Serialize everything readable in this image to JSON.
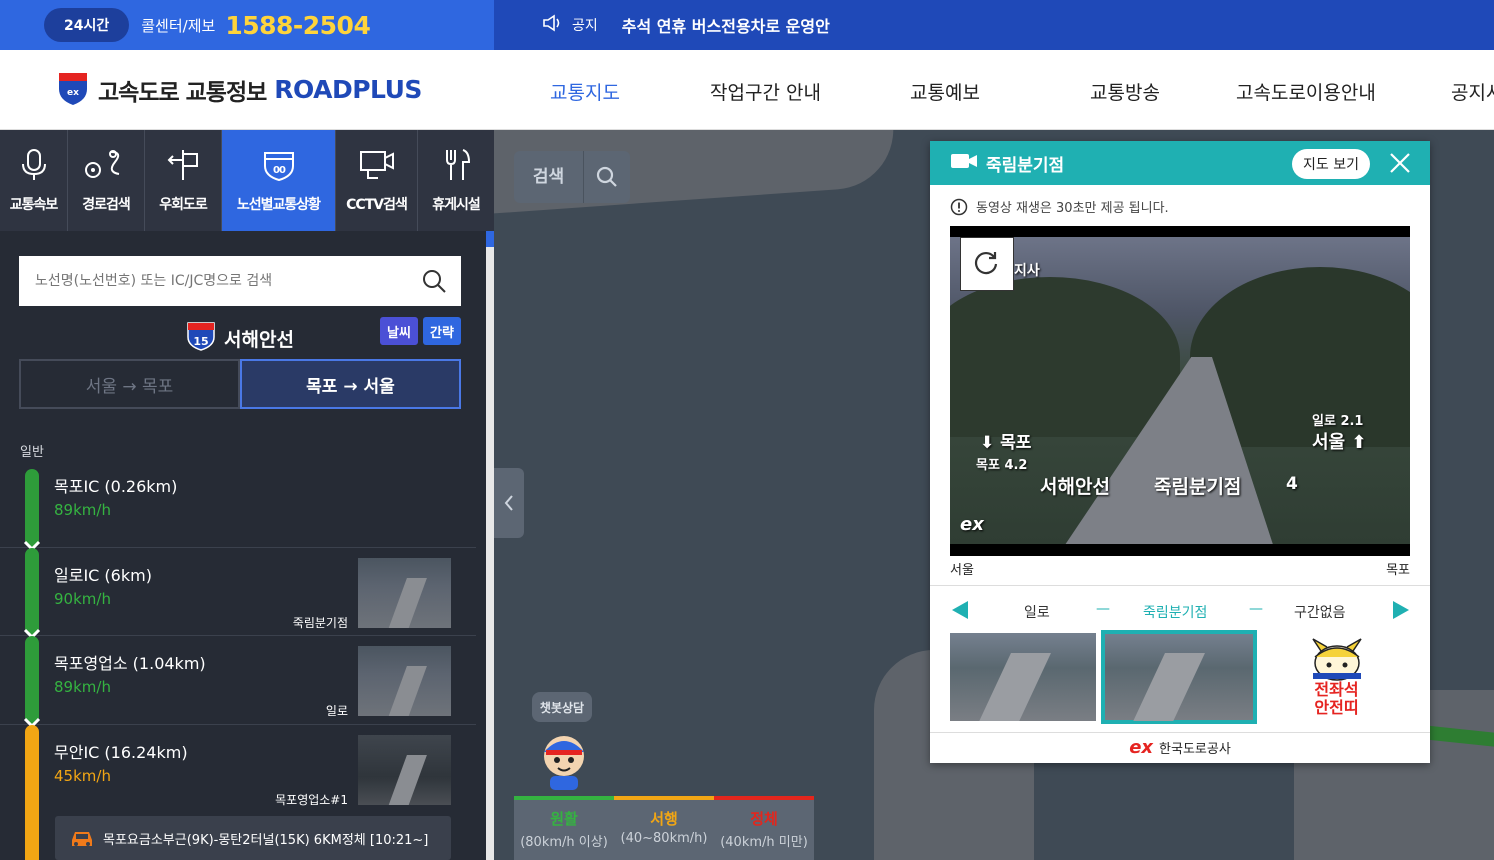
{
  "topbar": {
    "hours_badge": "24시간",
    "callcenter_label": "콜센터/제보",
    "phone": "1588-2504",
    "notice_label": "공지",
    "notice_text": "추석 연휴 버스전용차로 운영안"
  },
  "header": {
    "brand_ko": "고속도로 교통정보",
    "brand_en": "ROADPLUS",
    "nav": [
      {
        "label": "교통지도",
        "active": true
      },
      {
        "label": "작업구간 안내",
        "active": false
      },
      {
        "label": "교통예보",
        "active": false
      },
      {
        "label": "교통방송",
        "active": false
      },
      {
        "label": "고속도로이용안내",
        "active": false
      },
      {
        "label": "공지사",
        "active": false
      }
    ]
  },
  "tabs": [
    {
      "label": "교통속보",
      "icon": "microphone-icon",
      "active": false
    },
    {
      "label": "경로검색",
      "icon": "route-icon",
      "active": false
    },
    {
      "label": "우회도로",
      "icon": "detour-sign-icon",
      "active": false
    },
    {
      "label": "노선별교통상황",
      "icon": "route-shield-icon",
      "active": true
    },
    {
      "label": "CCTV검색",
      "icon": "monitor-icon",
      "active": false
    },
    {
      "label": "휴게시설",
      "icon": "fork-knife-icon",
      "active": false
    }
  ],
  "panel": {
    "search_placeholder": "노선명(노선번호) 또는 IC/JC명으로 검색",
    "route_number": "15",
    "route_name": "서해안선",
    "weather_btn": "날씨",
    "brief_btn": "간략",
    "dir_left": "서울 → 목포",
    "dir_right": "목포 → 서울",
    "general_label": "일반",
    "segments": [
      {
        "title": "목포IC (0.26km)",
        "speed": "89km/h",
        "color": "#2e9c3a",
        "speed_color": "#35b341",
        "cam_label": "",
        "has_thumb": false
      },
      {
        "title": "일로IC (6km)",
        "speed": "90km/h",
        "color": "#2e9c3a",
        "speed_color": "#35b341",
        "cam_label": "죽림분기점",
        "has_thumb": true
      },
      {
        "title": "목포영업소 (1.04km)",
        "speed": "89km/h",
        "color": "#2e9c3a",
        "speed_color": "#35b341",
        "cam_label": "일로",
        "has_thumb": true
      },
      {
        "title": "무안IC (16.24km)",
        "speed": "45km/h",
        "color": "#f2a614",
        "speed_color": "#f2a614",
        "cam_label": "목포영업소#1",
        "has_thumb": true
      }
    ],
    "incident_text": "목포요금소부근(9K)-몽탄2터널(15K) 6KM정체 [10:21~]"
  },
  "map": {
    "search_label": "검색",
    "chatbot_label": "챗봇상담",
    "legend": [
      {
        "name": "원활",
        "range": "(80km/h 이상)",
        "color": "#35b341"
      },
      {
        "name": "서행",
        "range": "(40~80km/h)",
        "color": "#f2a614"
      },
      {
        "name": "정체",
        "range": "(40km/h 미만)",
        "color": "#e3261d"
      }
    ]
  },
  "popup": {
    "title": "죽림분기점",
    "map_btn": "지도 보기",
    "notice": "동영상 재생은 30초만 제공 됩니다.",
    "video_overlay": {
      "top_left": "지사",
      "dir_down": "목포",
      "km_left": "목포 4.2",
      "route": "서해안선",
      "junction": "죽림분기점",
      "number": "4",
      "km_right": "일로 2.1",
      "dir_up": "서울",
      "logo": "ex"
    },
    "cap_left": "서울",
    "cap_right": "목포",
    "nav_prev": "일로",
    "nav_current": "죽림분기점",
    "nav_next": "구간없음",
    "dash": "—",
    "ad_line1": "전좌석",
    "ad_line2": "안전띠",
    "corp": "한국도로공사",
    "corp_logo": "ex"
  }
}
